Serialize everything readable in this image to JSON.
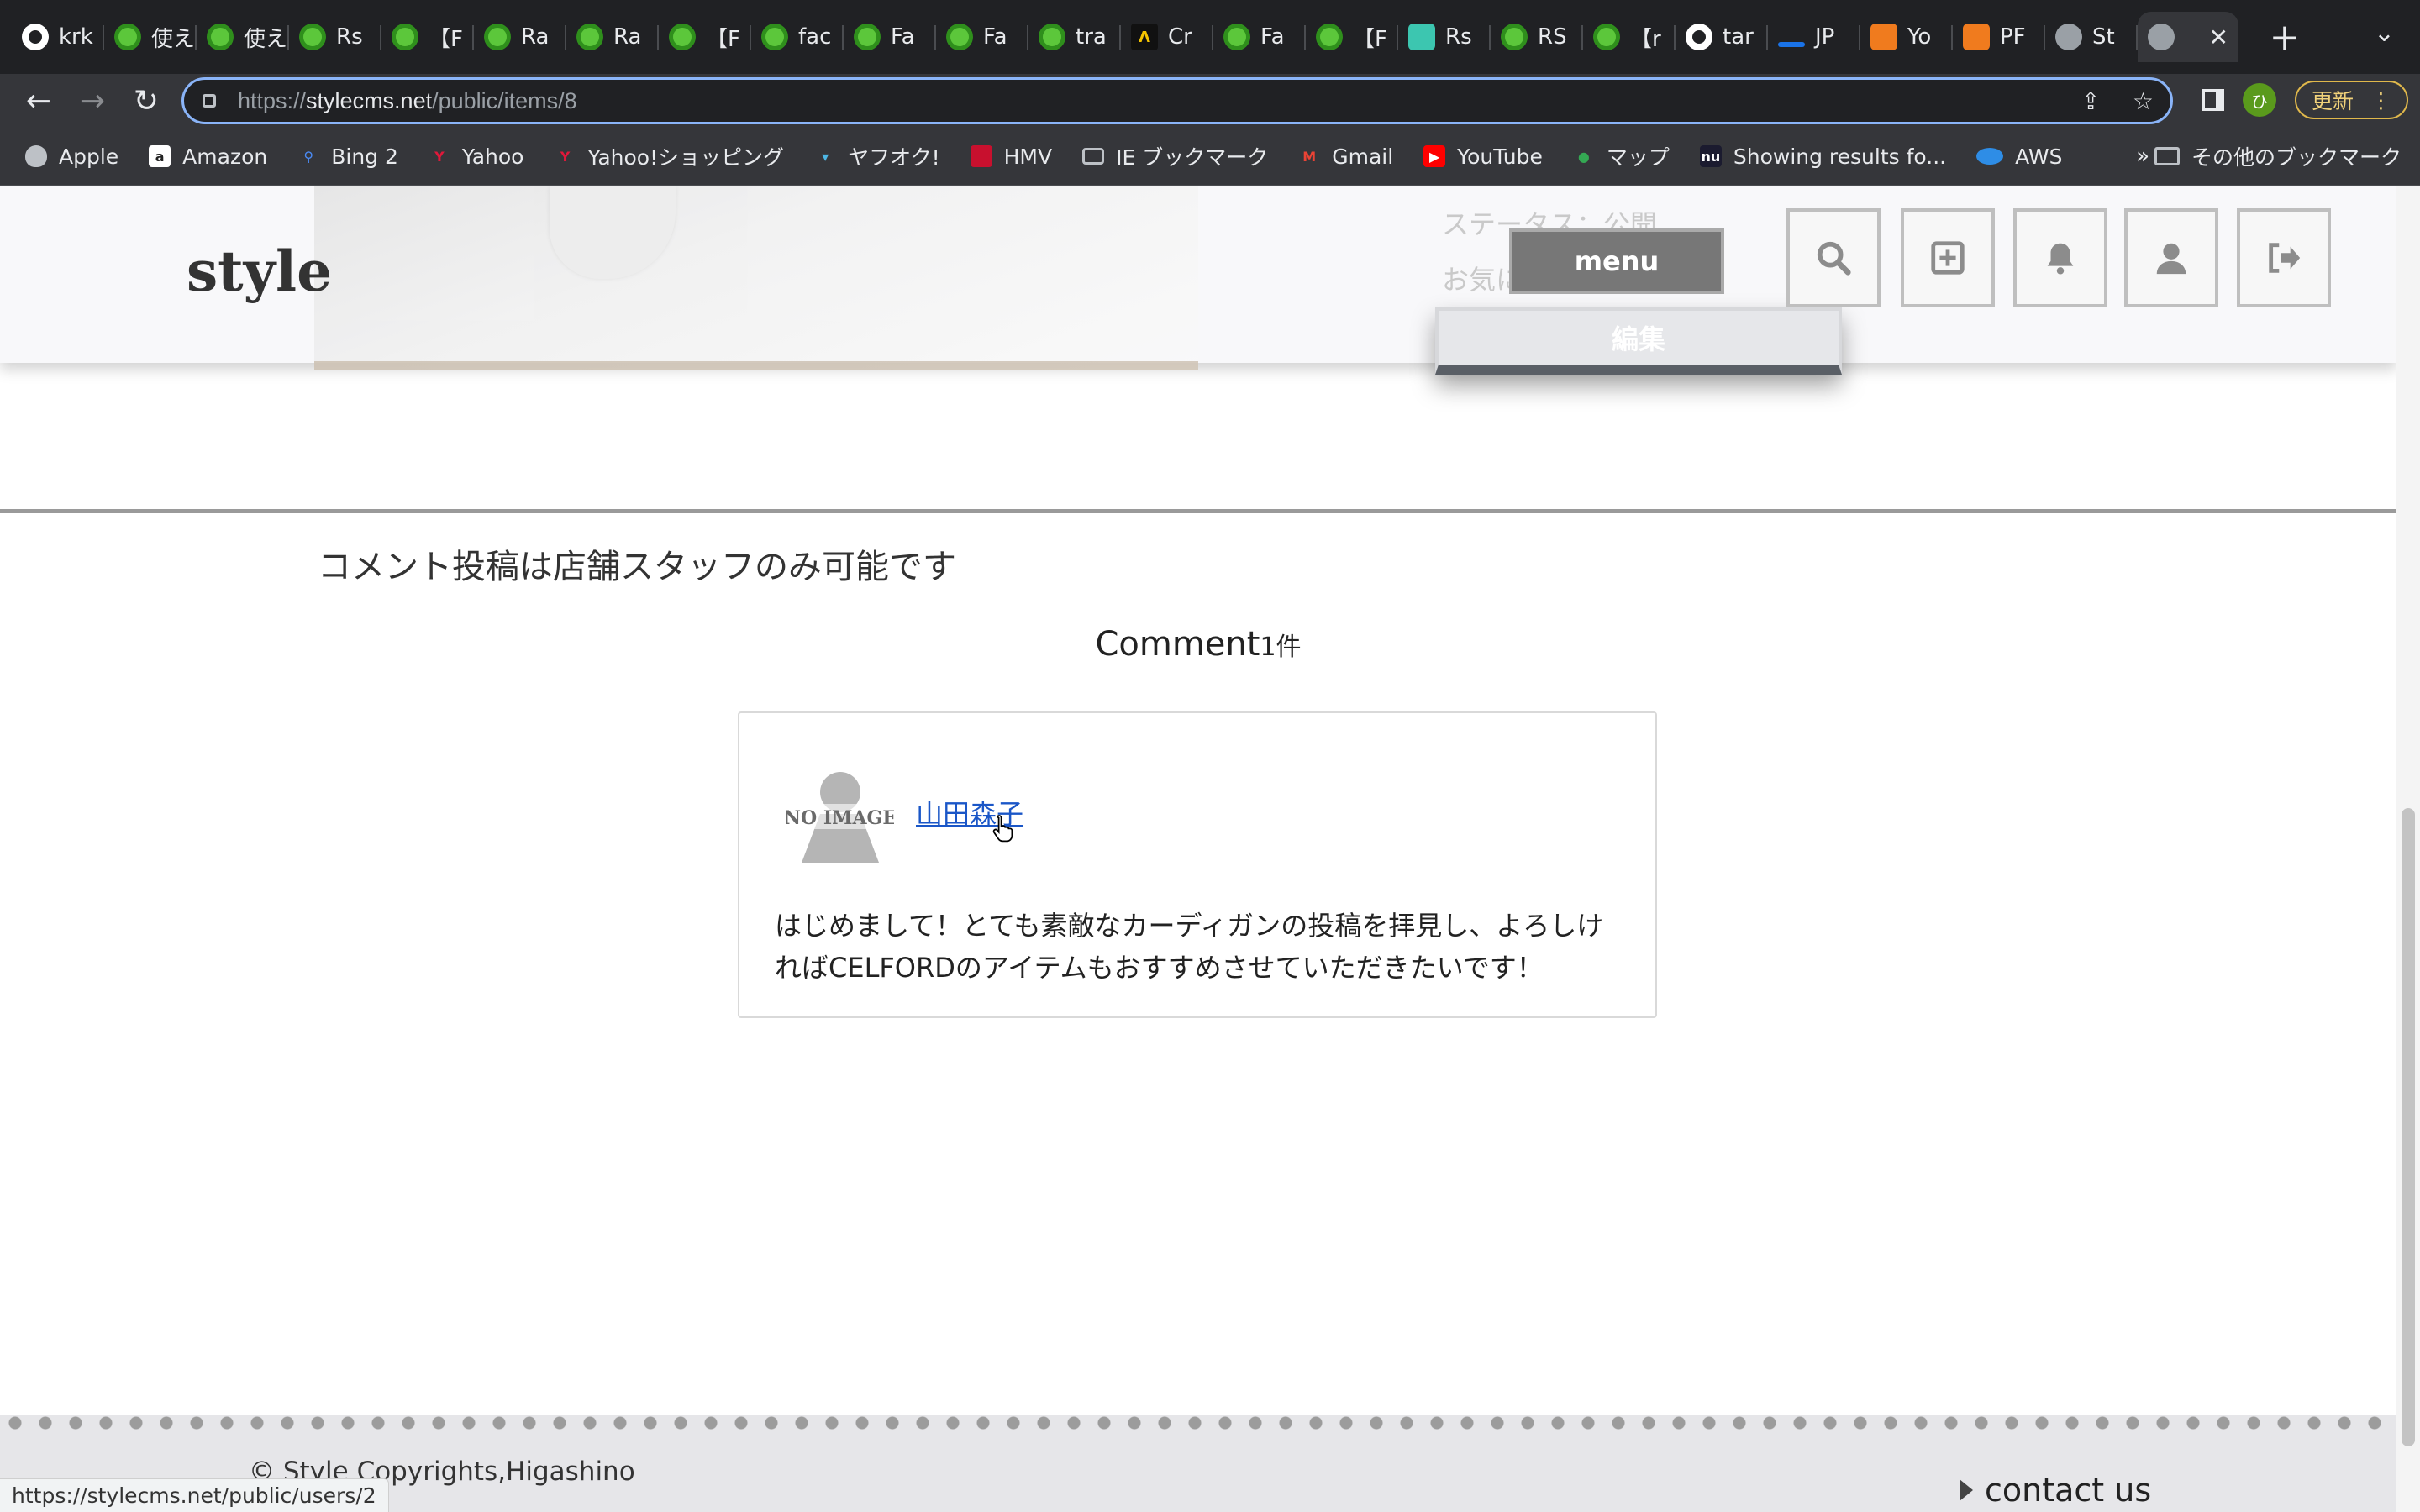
{
  "browser": {
    "tabs": [
      {
        "label": "krk",
        "icon": "github"
      },
      {
        "label": "使え",
        "icon": "green"
      },
      {
        "label": "使え",
        "icon": "green"
      },
      {
        "label": "Rs",
        "icon": "green"
      },
      {
        "label": "【F",
        "icon": "green"
      },
      {
        "label": "Ra",
        "icon": "green"
      },
      {
        "label": "Ra",
        "icon": "green"
      },
      {
        "label": "【F",
        "icon": "green"
      },
      {
        "label": "fac",
        "icon": "green"
      },
      {
        "label": "Fa",
        "icon": "green"
      },
      {
        "label": "Fa",
        "icon": "green"
      },
      {
        "label": "tra",
        "icon": "green"
      },
      {
        "label": "Cr",
        "icon": "cr"
      },
      {
        "label": "Fa",
        "icon": "green"
      },
      {
        "label": "【F",
        "icon": "green"
      },
      {
        "label": "Rs",
        "icon": "rs"
      },
      {
        "label": "RS",
        "icon": "green"
      },
      {
        "label": "【r",
        "icon": "green"
      },
      {
        "label": "tar",
        "icon": "github"
      },
      {
        "label": "JP",
        "icon": "jp"
      },
      {
        "label": "Yo",
        "icon": "box"
      },
      {
        "label": "PF",
        "icon": "box"
      },
      {
        "label": "St",
        "icon": "globe"
      }
    ],
    "active_tab_close": "✕",
    "new_tab": "+",
    "url_prefix": "https://",
    "url_host": "stylecms.net",
    "url_path": "/public/items/8",
    "profile_initial": "ひ",
    "update_label": "更新",
    "bookmarks": [
      {
        "label": "Apple",
        "icon": "apple-icon"
      },
      {
        "label": "Amazon",
        "icon": "amazon-icon"
      },
      {
        "label": "Bing 2",
        "icon": "search-icon"
      },
      {
        "label": "Yahoo",
        "icon": "yahoo-icon"
      },
      {
        "label": "Yahoo!ショッピング",
        "icon": "yahoo-icon"
      },
      {
        "label": "ヤフオク!",
        "icon": "yafuoku-icon"
      },
      {
        "label": "HMV",
        "icon": "hmv-icon"
      },
      {
        "label": "IE ブックマーク",
        "icon": "folder-icon"
      },
      {
        "label": "Gmail",
        "icon": "gmail-icon"
      },
      {
        "label": "YouTube",
        "icon": "youtube-icon"
      },
      {
        "label": "マップ",
        "icon": "maps-icon"
      },
      {
        "label": "Showing results fo...",
        "icon": "nu-icon"
      },
      {
        "label": "AWS",
        "icon": "aws-icon"
      }
    ],
    "bookmarks_more": "»",
    "other_bookmarks": "その他のブックマーク",
    "status_url": "https://stylecms.net/public/users/2"
  },
  "site": {
    "logo": "style",
    "status_text": "ステータス：公開",
    "favorites_text": "お気に入り：0件",
    "menu_label": "menu",
    "edit_label": "編集",
    "header_icons": [
      "search-icon",
      "plus-square-icon",
      "bell-icon",
      "user-icon",
      "logout-icon"
    ]
  },
  "comments": {
    "notice": "コメント投稿は店舗スタッフのみ可能です",
    "title": "Comment",
    "count": "1件",
    "items": [
      {
        "avatar_text": "NO IMAGE",
        "author": "山田森子",
        "body": "はじめまして！とても素敵なカーディガンの投稿を拝見し、よろしければCELFORDのアイテムもおすすめさせていただきたいです！"
      }
    ]
  },
  "footer": {
    "copyright": "© Style Copyrights,Higashino",
    "contact": "contact us"
  },
  "colors": {
    "browser_dark": "#202124",
    "toolbar": "#35363a",
    "link": "#1a56c7",
    "menu_button": "#777777"
  }
}
